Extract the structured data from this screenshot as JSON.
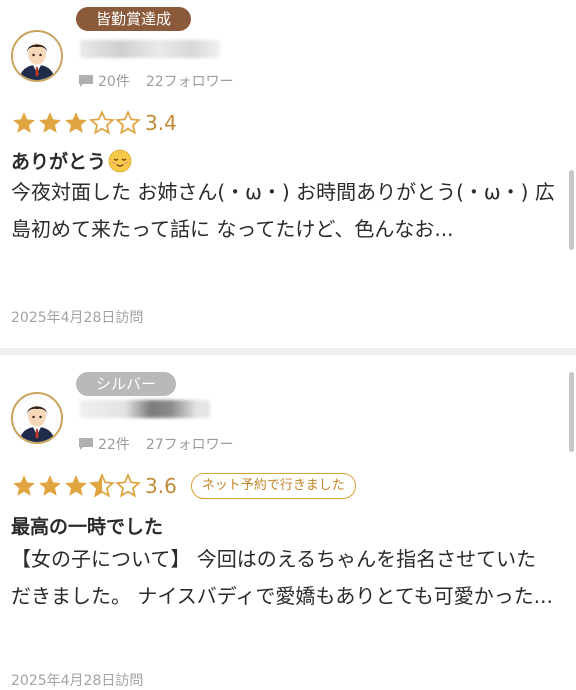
{
  "reviews": [
    {
      "badge": "皆勤賞達成",
      "badge_color": "#8b5a3a",
      "avatar_icon": "user-avatar-icon",
      "post_count": "20件",
      "follower_count": "22フォロワー",
      "rating": 3.4,
      "rating_text": "3.4",
      "title": "ありがとう",
      "title_emoji": "relieved-face-emoji",
      "body": "今夜対面した お姉さん(・ω・) お時間ありがとう(・ω・) 広島初めて来たって話に なってたけど、色んなお...",
      "visit_date": "2025年4月28日訪問"
    },
    {
      "badge": "シルバー",
      "badge_color": "#b9b9b9",
      "avatar_icon": "user-avatar-icon",
      "post_count": "22件",
      "follower_count": "27フォロワー",
      "rating": 3.6,
      "rating_text": "3.6",
      "net_badge": "ネット予約で行きました",
      "title": "最高の一時でした",
      "body": "【女の子について】 今回はのえるちゃんを指名させていただきました。 ナイスバディで愛嬌もありとても可愛かった...",
      "visit_date": "2025年4月28日訪問"
    }
  ],
  "colors": {
    "star": "#e0a440",
    "rating_text": "#c08a3a",
    "badge_outline": "#d9a23d"
  }
}
